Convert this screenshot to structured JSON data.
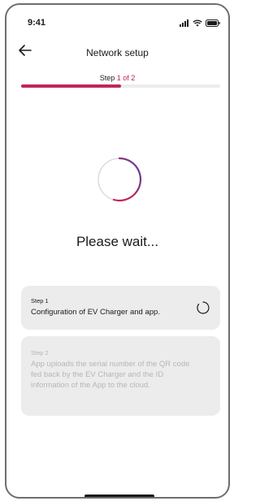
{
  "status_bar": {
    "time": "9:41"
  },
  "header": {
    "title": "Network setup"
  },
  "step_indicator": {
    "prefix": "Step ",
    "current": "1",
    "separator": " of ",
    "total": "2"
  },
  "progress": {
    "fraction": 0.5,
    "color": "#c1245c"
  },
  "loading": {
    "message": "Please wait..."
  },
  "steps": [
    {
      "label": "Step 1",
      "description": "Configuration of EV Charger and app.",
      "state": "active"
    },
    {
      "label": "Step 2",
      "description": "App uploads the serial number of the QR code fed back by the EV Charger and the ID information of the App to the cloud.",
      "state": "pending"
    }
  ],
  "icons": {
    "back": "back-arrow-icon",
    "signal": "cellular-signal-icon",
    "wifi": "wifi-icon",
    "battery": "battery-icon",
    "spinner": "loading-spinner-icon"
  },
  "colors": {
    "accent": "#c1245c",
    "spinner_gradient_start": "#5b3fa0",
    "card_bg": "#ececed",
    "muted_text": "#b6b6bb"
  }
}
